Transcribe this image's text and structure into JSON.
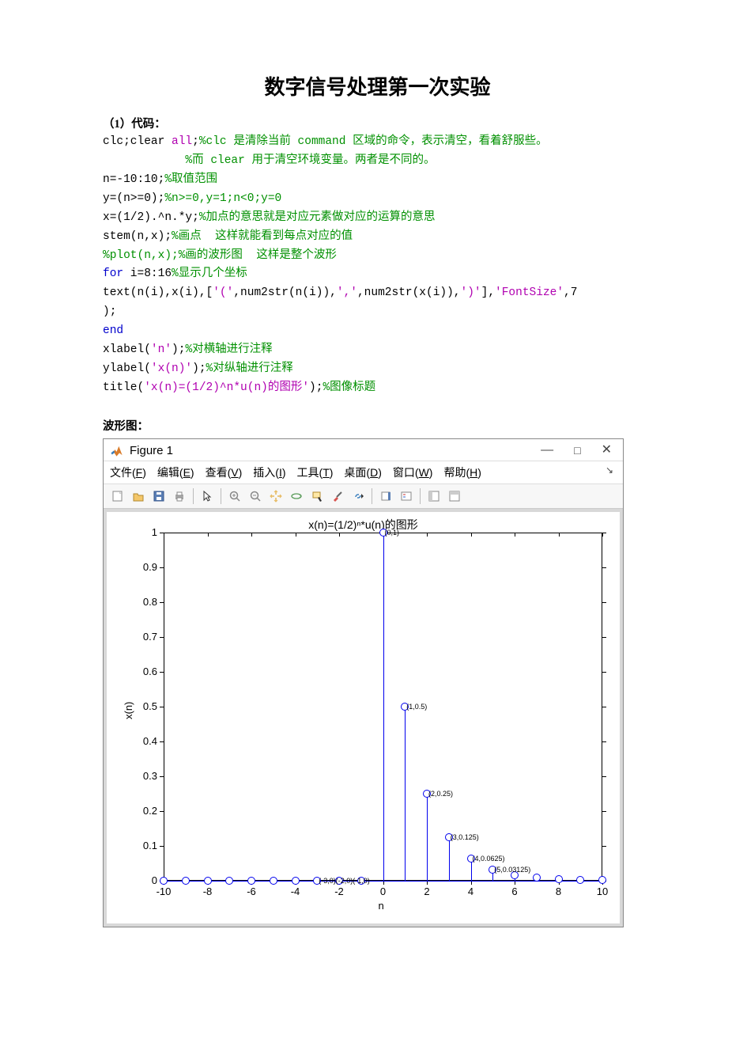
{
  "page_title": "数字信号处理第一次实验",
  "section1_heading": "（1）代码：",
  "code": {
    "l1a": "clc;clear ",
    "l1b": "all",
    "l1c": ";",
    "l1cmt": "%clc 是清除当前 command 区域的命令，表示清空，看着舒服些。",
    "l2cmt": "%而 clear 用于清空环境变量。两者是不同的。",
    "l3": "n=-10:10;",
    "l3cmt": "%取值范围",
    "l4": "y=(n>=0);",
    "l4cmt": "%n>=0,y=1;n<0;y=0",
    "l5": "x=(1/2).^n.*y;",
    "l5cmt": "%加点的意思就是对应元素做对应的运算的意思",
    "l6": "stem(n,x);",
    "l6cmt": "%画点  这样就能看到每点对应的值",
    "l7cmt": "%plot(n,x);%画的波形图  这样是整个波形",
    "l8a": "for",
    "l8b": " i=8:16",
    "l8cmt": "%显示几个坐标",
    "l9a": "text(n(i),x(i),[",
    "l9s1": "'('",
    "l9b": ",num2str(n(i)),",
    "l9s2": "','",
    "l9c": ",num2str(x(i)),",
    "l9s3": "')'",
    "l9d": "],",
    "l9s4": "'FontSize'",
    "l9e": ",7",
    "l10": ");",
    "l11": "end",
    "l12a": "xlabel(",
    "l12s": "'n'",
    "l12b": ");",
    "l12cmt": "%对横轴进行注释",
    "l13a": "ylabel(",
    "l13s": "'x(n)'",
    "l13b": ");",
    "l13cmt": "%对纵轴进行注释",
    "l14a": "title(",
    "l14s": "'x(n)=(1/2)^n*u(n)的图形'",
    "l14b": ");",
    "l14cmt": "%图像标题"
  },
  "waveform_heading": "波形图：",
  "figure_window": {
    "title": "Figure 1",
    "menus": [
      "文件(F)",
      "编辑(E)",
      "查看(V)",
      "插入(I)",
      "工具(T)",
      "桌面(D)",
      "窗口(W)",
      "帮助(H)"
    ]
  },
  "chart_data": {
    "type": "stem",
    "title": "x(n)=(1/2)ⁿ*u(n)的图形",
    "xlabel": "n",
    "ylabel": "x(n)",
    "xlim": [
      -10,
      10
    ],
    "ylim": [
      0,
      1
    ],
    "xticks": [
      -10,
      -8,
      -6,
      -4,
      -2,
      0,
      2,
      4,
      6,
      8,
      10
    ],
    "yticks": [
      0,
      0.1,
      0.2,
      0.3,
      0.4,
      0.5,
      0.6,
      0.7,
      0.8,
      0.9,
      1
    ],
    "n": [
      -10,
      -9,
      -8,
      -7,
      -6,
      -5,
      -4,
      -3,
      -2,
      -1,
      0,
      1,
      2,
      3,
      4,
      5,
      6,
      7,
      8,
      9,
      10
    ],
    "y": [
      0,
      0,
      0,
      0,
      0,
      0,
      0,
      0,
      0,
      0,
      1,
      0.5,
      0.25,
      0.125,
      0.0625,
      0.03125,
      0.015625,
      0.0078125,
      0.00390625,
      0.001953125,
      0.0009765625
    ],
    "annotations": [
      {
        "x": -3,
        "y": 0,
        "text": "(-3,0)(-2,0)(-1,0)"
      },
      {
        "x": 0,
        "y": 1,
        "text": "(0,1)"
      },
      {
        "x": 1,
        "y": 0.5,
        "text": "(1,0.5)"
      },
      {
        "x": 2,
        "y": 0.25,
        "text": "(2,0.25)"
      },
      {
        "x": 3,
        "y": 0.125,
        "text": "(3,0.125)"
      },
      {
        "x": 4,
        "y": 0.0625,
        "text": "(4,0.0625)"
      },
      {
        "x": 5,
        "y": 0.03125,
        "text": "(5,0.03125)"
      }
    ]
  }
}
